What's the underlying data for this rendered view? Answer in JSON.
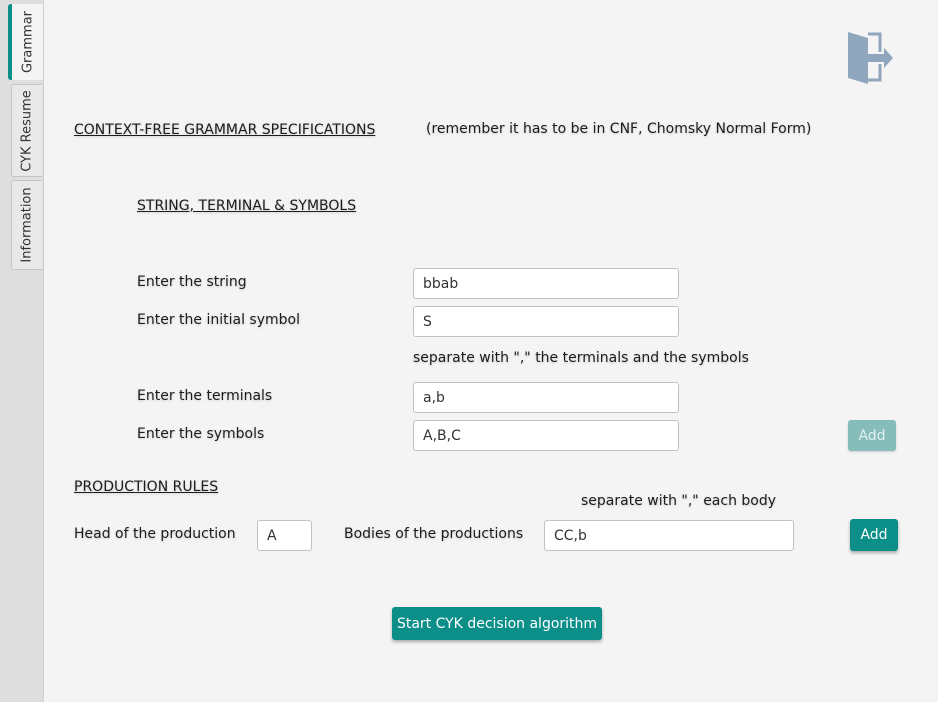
{
  "sidebar": {
    "tabs": [
      {
        "label": "Grammar",
        "active": true
      },
      {
        "label": "CYK Resume",
        "active": false
      },
      {
        "label": "Information",
        "active": false
      }
    ]
  },
  "header": {
    "exit_icon": "exit-door-icon"
  },
  "grammar_section": {
    "title": "CONTEXT-FREE GRAMMAR SPECIFICATIONS",
    "note": "(remember it has to be in CNF, Chomsky Normal Form)"
  },
  "symbols_section": {
    "title": "STRING, TERMINAL & SYMBOLS",
    "string_label": "Enter the string",
    "string_value": "bbab",
    "initial_label": "Enter the initial symbol",
    "initial_value": "S",
    "separator_hint": "separate with \",\" the terminals and the symbols",
    "terminals_label": "Enter the terminals",
    "terminals_value": "a,b",
    "symbols_label": "Enter the symbols",
    "symbols_value": "A,B,C",
    "add_label": "Add"
  },
  "production_section": {
    "title": "PRODUCTION RULES",
    "body_hint": "separate with \",\" each body",
    "head_label": "Head of the production",
    "head_value": "A",
    "bodies_label": "Bodies of the productions",
    "bodies_value": "CC,b",
    "add_label": "Add"
  },
  "actions": {
    "start_label": "Start CYK decision algorithm"
  },
  "colors": {
    "accent": "#0b8f88",
    "accent_disabled": "#86bdba",
    "background": "#f4f4f4",
    "sidebar": "#dedede",
    "exit_icon": "#8fa6bd"
  }
}
